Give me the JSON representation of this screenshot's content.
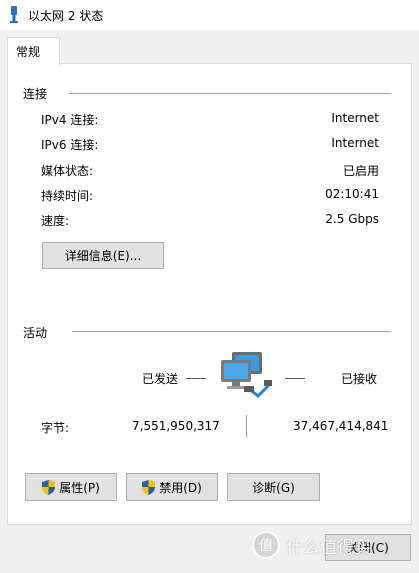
{
  "window": {
    "title": "以太网 2 状态"
  },
  "tabs": [
    {
      "label": "常规"
    }
  ],
  "connection": {
    "heading": "连接",
    "rows": [
      {
        "label": "IPv4 连接:",
        "value": "Internet"
      },
      {
        "label": "IPv6 连接:",
        "value": "Internet"
      },
      {
        "label": "媒体状态:",
        "value": "已启用"
      },
      {
        "label": "持续时间:",
        "value": "02:10:41"
      },
      {
        "label": "速度:",
        "value": "2.5 Gbps"
      }
    ],
    "details_button": "详细信息(E)..."
  },
  "activity": {
    "heading": "活动",
    "sent_label": "已发送",
    "received_label": "已接收",
    "bytes_label": "字节:",
    "bytes_sent": "7,551,950,317",
    "bytes_received": "37,467,414,841"
  },
  "buttons": {
    "properties": "属性(P)",
    "disable": "禁用(D)",
    "diagnose": "诊断(G)",
    "close": "关闭(C)"
  },
  "watermark": {
    "text": "什么值得买"
  },
  "colors": {
    "title_bg": "#ffffff",
    "window_bg": "#f0f0f0",
    "button_bg": "#e1e1e1",
    "shield_blue": "#2a5caa",
    "shield_yellow": "#f5c400"
  }
}
